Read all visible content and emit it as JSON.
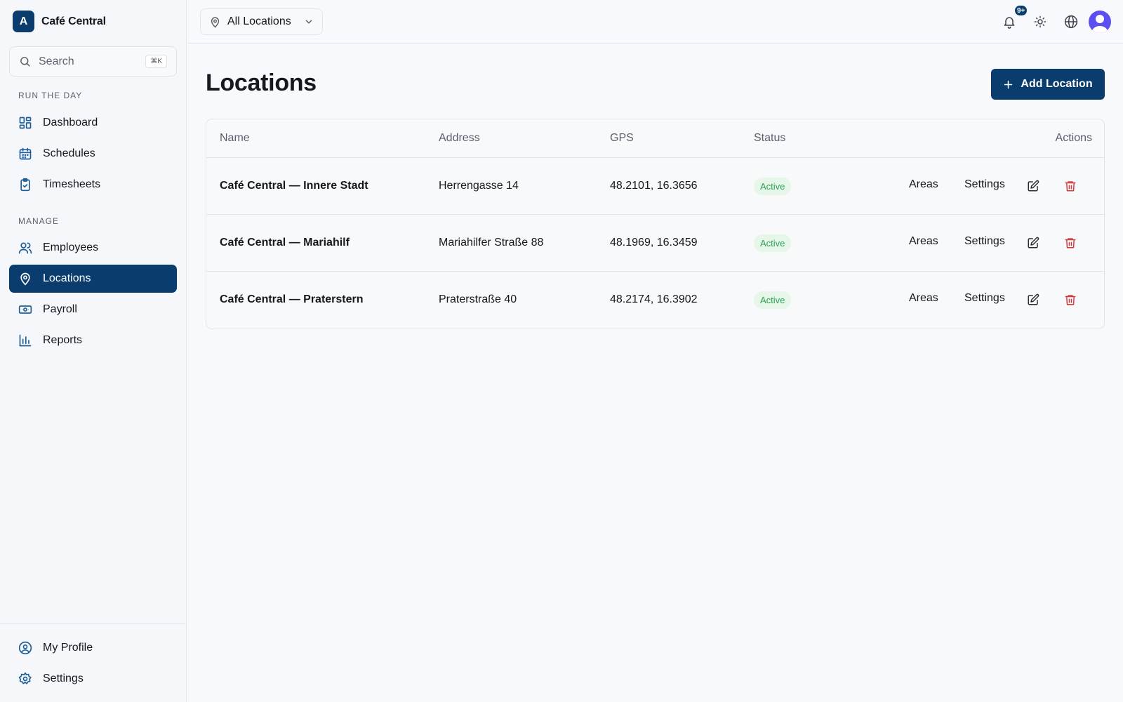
{
  "brand": {
    "logo_letter": "A",
    "name": "Café Central"
  },
  "search": {
    "placeholder": "Search",
    "shortcut": "⌘K"
  },
  "sidebar": {
    "sections": [
      {
        "label": "RUN THE DAY"
      },
      {
        "label": "MANAGE"
      }
    ],
    "items": [
      {
        "label": "Dashboard",
        "icon": "dashboard-icon"
      },
      {
        "label": "Schedules",
        "icon": "calendar-icon"
      },
      {
        "label": "Timesheets",
        "icon": "clipboard-check-icon"
      },
      {
        "label": "Employees",
        "icon": "users-icon"
      },
      {
        "label": "Locations",
        "icon": "map-pin-icon",
        "active": true
      },
      {
        "label": "Payroll",
        "icon": "banknote-icon"
      },
      {
        "label": "Reports",
        "icon": "bar-chart-icon"
      }
    ],
    "footer": [
      {
        "label": "My Profile",
        "icon": "user-circle-icon"
      },
      {
        "label": "Settings",
        "icon": "gear-icon"
      }
    ]
  },
  "topbar": {
    "location_select": {
      "value": "All Locations"
    },
    "notifications": {
      "badge": "9+"
    }
  },
  "main": {
    "title": "Locations",
    "add_button_label": "Add Location",
    "table": {
      "headers": {
        "name": "Name",
        "address": "Address",
        "gps": "GPS",
        "status": "Status",
        "actions": "Actions"
      },
      "rows": [
        {
          "name": "Café Central — Innere Stadt",
          "address": "Herrengasse 14",
          "gps": "48.2101, 16.3656",
          "status": "Active"
        },
        {
          "name": "Café Central — Mariahilf",
          "address": "Mariahilfer Straße 88",
          "gps": "48.1969, 16.3459",
          "status": "Active"
        },
        {
          "name": "Café Central — Praterstern",
          "address": "Praterstraße 40",
          "gps": "48.2174, 16.3902",
          "status": "Active"
        }
      ],
      "row_actions": {
        "areas": "Areas",
        "settings": "Settings"
      }
    }
  },
  "colors": {
    "brand": "#0a3d6e",
    "nav_icon": "#1c5d99",
    "status_active_bg": "#e6f7ea",
    "status_active_text": "#2e9f55",
    "danger": "#d33c3c",
    "avatar": "#5b4ff2"
  }
}
